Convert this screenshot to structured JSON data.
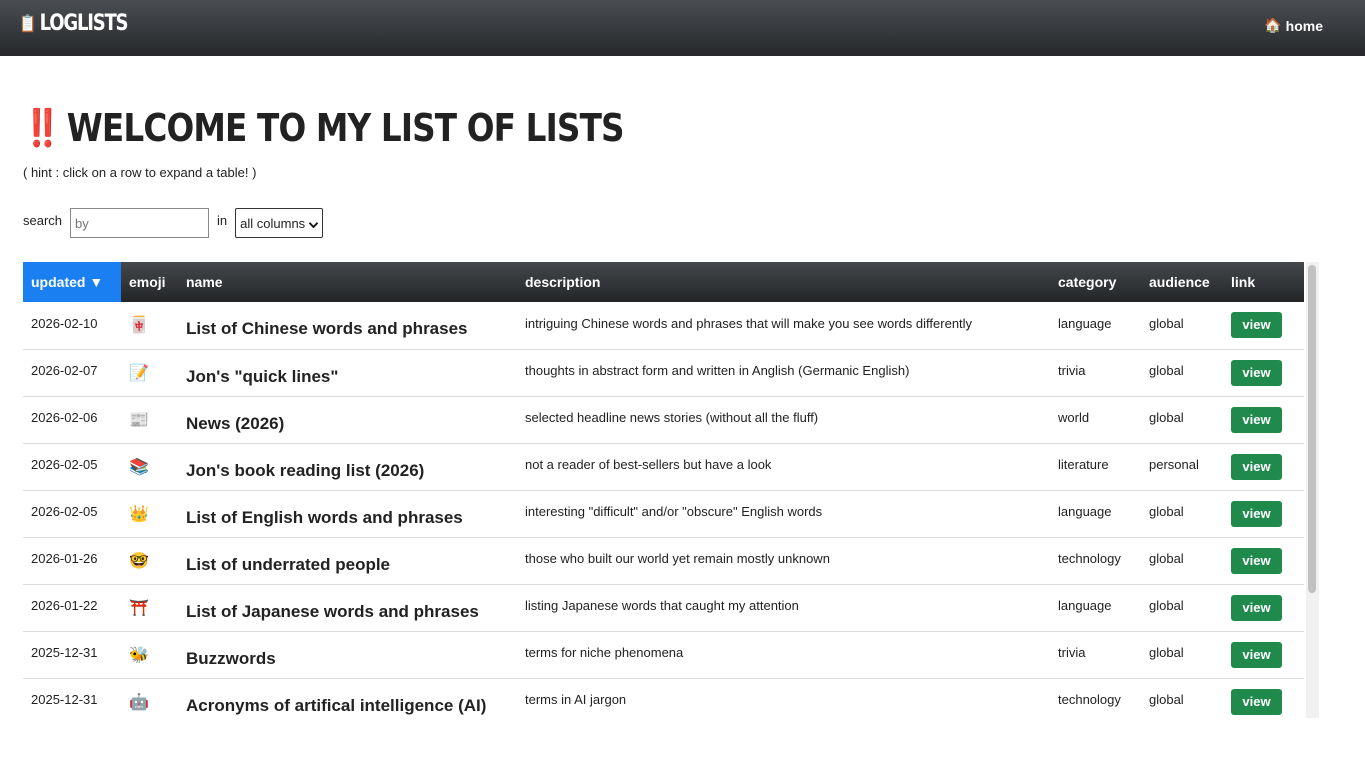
{
  "header": {
    "brand_icon": "📋",
    "brand": "LOGLISTS",
    "home_icon": "🏠",
    "home_label": "home"
  },
  "page": {
    "title_icon": "‼️",
    "title": "WELCOME TO MY LIST OF LISTS",
    "hint": "( hint : click on a row to expand a table! )"
  },
  "search": {
    "label": "search",
    "placeholder": "by",
    "in_label": "in",
    "selected_option": "all columns"
  },
  "table": {
    "columns": [
      "updated ▼",
      "emoji",
      "name",
      "description",
      "category",
      "audience",
      "link"
    ],
    "rows": [
      {
        "updated": "2026-02-10",
        "emoji": "🀄",
        "name": "List of Chinese words and phrases",
        "description": "intriguing Chinese words and phrases that will make you see words differently",
        "category": "language",
        "audience": "global",
        "link": "view"
      },
      {
        "updated": "2026-02-07",
        "emoji": "📝",
        "name": "Jon's \"quick lines\"",
        "description": "thoughts in abstract form and written in Anglish (Germanic English)",
        "category": "trivia",
        "audience": "global",
        "link": "view"
      },
      {
        "updated": "2026-02-06",
        "emoji": "📰",
        "name": "News (2026)",
        "description": "selected headline news stories (without all the fluff)",
        "category": "world",
        "audience": "global",
        "link": "view"
      },
      {
        "updated": "2026-02-05",
        "emoji": "📚",
        "name": "Jon's book reading list (2026)",
        "description": "not a reader of best-sellers but have a look",
        "category": "literature",
        "audience": "personal",
        "link": "view"
      },
      {
        "updated": "2026-02-05",
        "emoji": "👑",
        "name": "List of English words and phrases",
        "description": "interesting \"difficult\" and/or \"obscure\" English words",
        "category": "language",
        "audience": "global",
        "link": "view"
      },
      {
        "updated": "2026-01-26",
        "emoji": "🤓",
        "name": "List of underrated people",
        "description": "those who built our world yet remain mostly unknown",
        "category": "technology",
        "audience": "global",
        "link": "view"
      },
      {
        "updated": "2026-01-22",
        "emoji": "⛩️",
        "name": "List of Japanese words and phrases",
        "description": "listing Japanese words that caught my attention",
        "category": "language",
        "audience": "global",
        "link": "view"
      },
      {
        "updated": "2025-12-31",
        "emoji": "🐝",
        "name": "Buzzwords",
        "description": "terms for niche phenomena",
        "category": "trivia",
        "audience": "global",
        "link": "view"
      },
      {
        "updated": "2025-12-31",
        "emoji": "🤖",
        "name": "Acronyms of artifical intelligence (AI)",
        "description": "terms in AI jargon",
        "category": "technology",
        "audience": "global",
        "link": "view"
      }
    ]
  },
  "colors": {
    "header_bg": "#2f3135",
    "active_sort": "#1a7ff0",
    "view_button": "#1f8a4c",
    "title_icon": "#e0201b"
  }
}
